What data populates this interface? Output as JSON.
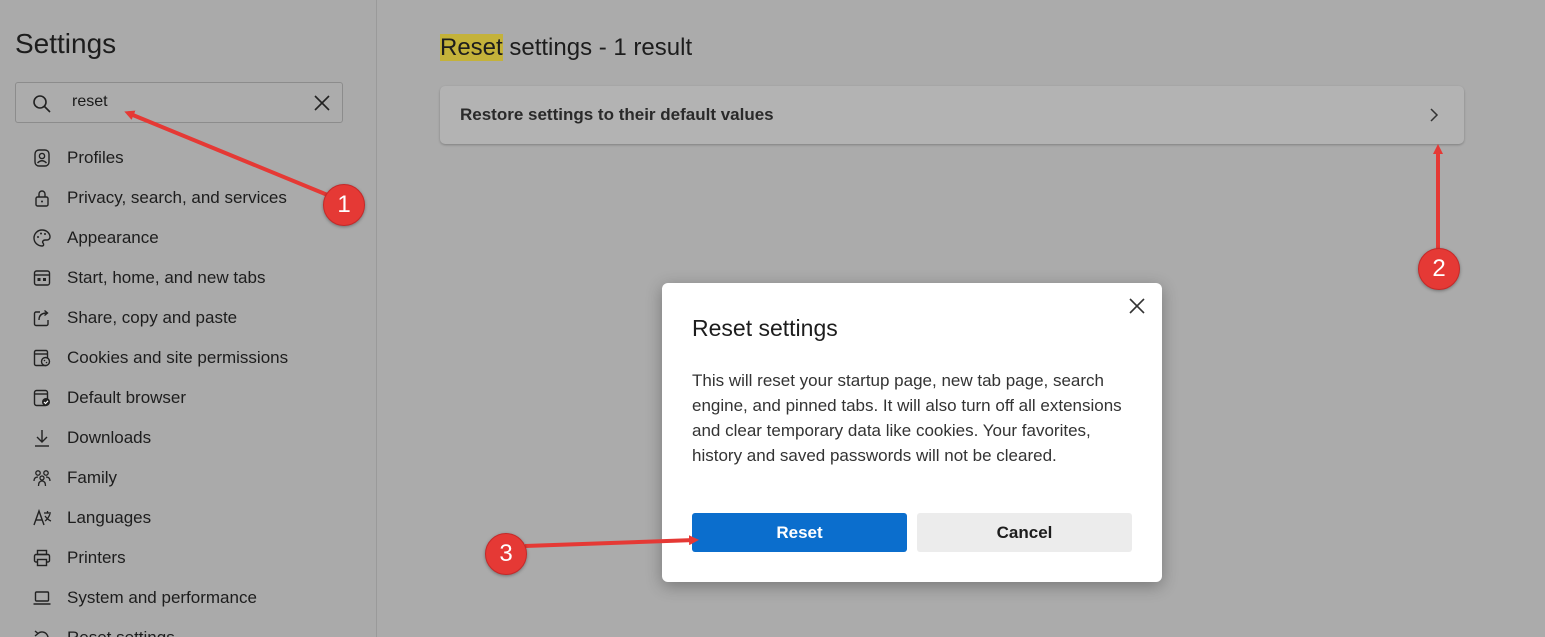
{
  "sidebar": {
    "title": "Settings",
    "search": {
      "value": "reset",
      "icon": "search-icon",
      "clear_icon": "close-icon"
    },
    "items": [
      {
        "label": "Profiles",
        "icon": "profile-icon"
      },
      {
        "label": "Privacy, search, and services",
        "icon": "lock-icon"
      },
      {
        "label": "Appearance",
        "icon": "palette-icon"
      },
      {
        "label": "Start, home, and new tabs",
        "icon": "home-tabs-icon"
      },
      {
        "label": "Share, copy and paste",
        "icon": "share-icon"
      },
      {
        "label": "Cookies and site permissions",
        "icon": "cookies-icon"
      },
      {
        "label": "Default browser",
        "icon": "default-browser-icon"
      },
      {
        "label": "Downloads",
        "icon": "download-icon"
      },
      {
        "label": "Family",
        "icon": "family-icon"
      },
      {
        "label": "Languages",
        "icon": "languages-icon"
      },
      {
        "label": "Printers",
        "icon": "printer-icon"
      },
      {
        "label": "System and performance",
        "icon": "laptop-icon"
      },
      {
        "label": "Reset settings",
        "icon": "reset-icon"
      }
    ]
  },
  "main": {
    "heading_highlight": "Reset",
    "heading_rest": " settings - 1 result",
    "result_card": {
      "label": "Restore settings to their default values",
      "icon": "chevron-right-icon"
    }
  },
  "dialog": {
    "title": "Reset settings",
    "body": "This will reset your startup page, new tab page, search engine, and pinned tabs. It will also turn off all extensions and clear temporary data like cookies. Your favorites, history and saved passwords will not be cleared.",
    "reset_label": "Reset",
    "cancel_label": "Cancel",
    "close_icon": "close-icon"
  },
  "annotations": {
    "badges": [
      "1",
      "2",
      "3"
    ],
    "color": "#e53935"
  },
  "colors": {
    "accent": "#0b6ecd",
    "highlight": "#c4b23a",
    "overlay_bg": "#ababab"
  }
}
